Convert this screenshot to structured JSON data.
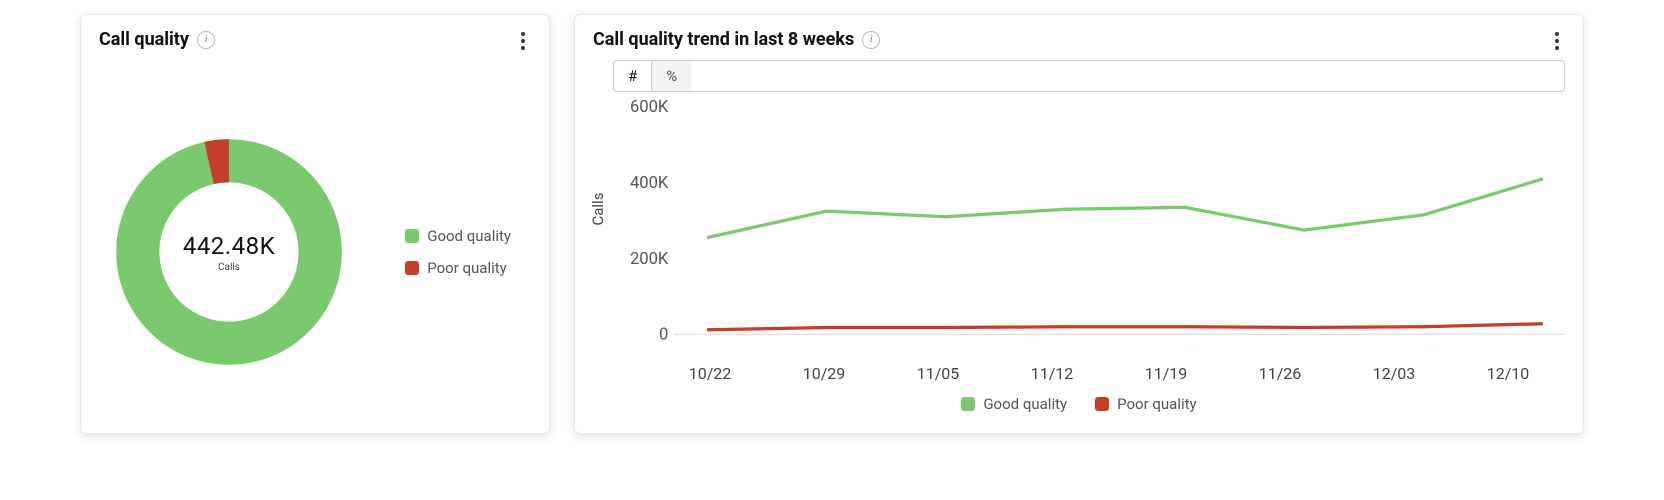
{
  "donut_card": {
    "title": "Call quality",
    "center_value": "442.48K",
    "center_sub": "Calls",
    "legend": [
      {
        "label": "Good quality",
        "color": "#7bc96f"
      },
      {
        "label": "Poor quality",
        "color": "#c43e2a"
      }
    ]
  },
  "trend_card": {
    "title": "Call quality trend in last 8 weeks",
    "toggles": {
      "count": "#",
      "pct": "%"
    },
    "ylabel": "Calls",
    "yticks": [
      "0",
      "200K",
      "400K",
      "600K"
    ],
    "xticks": [
      "10/22",
      "10/29",
      "11/05",
      "11/12",
      "11/19",
      "11/26",
      "12/03",
      "12/10"
    ],
    "legend": [
      {
        "label": "Good quality",
        "color": "#7bc96f"
      },
      {
        "label": "Poor quality",
        "color": "#c43e2a"
      }
    ]
  },
  "chart_data": [
    {
      "type": "pie",
      "title": "Call quality",
      "total_label": "442.48K Calls",
      "series": [
        {
          "name": "Good quality",
          "value": 426000,
          "pct": 96.3,
          "color": "#7bc96f"
        },
        {
          "name": "Poor quality",
          "value": 16480,
          "pct": 3.7,
          "color": "#c43e2a"
        }
      ]
    },
    {
      "type": "line",
      "title": "Call quality trend in last 8 weeks",
      "xlabel": "",
      "ylabel": "Calls",
      "ylim": [
        0,
        600000
      ],
      "categories": [
        "10/22",
        "10/29",
        "11/05",
        "11/12",
        "11/19",
        "11/26",
        "12/03",
        "12/10"
      ],
      "series": [
        {
          "name": "Good quality",
          "color": "#7bc96f",
          "values": [
            255000,
            325000,
            310000,
            330000,
            335000,
            275000,
            315000,
            410000
          ]
        },
        {
          "name": "Poor quality",
          "color": "#c43e2a",
          "values": [
            12000,
            18000,
            18000,
            20000,
            20000,
            18000,
            20000,
            28000
          ]
        }
      ]
    }
  ]
}
